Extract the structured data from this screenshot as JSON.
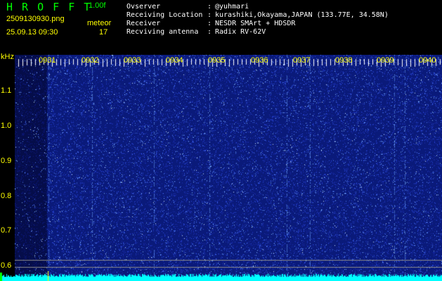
{
  "header": {
    "app_title": "H R O F F T",
    "version": "1.00f",
    "filename": "2509130930.png",
    "datetime": "25.09.13 09:30",
    "meteor_label": "meteor",
    "meteor_count": "17"
  },
  "station_info": [
    {
      "key": "Ovserver",
      "value": "@yuhmari"
    },
    {
      "key": "Receiving Location",
      "value": "kurashiki,Okayama,JAPAN (133.77E, 34.58N)"
    },
    {
      "key": "Receiver",
      "value": "NESDR SMArt + HDSDR"
    },
    {
      "key": "Recviving antenna",
      "value": "Radix RV-62V"
    }
  ],
  "axis": {
    "unit": "kHz",
    "freq_labels": [
      "1.1",
      "1.0",
      "0.9",
      "0.8",
      "0.7",
      "0.6"
    ],
    "time_labels": [
      "0931",
      "0932",
      "0933",
      "0934",
      "0935",
      "0936",
      "0937",
      "0938",
      "0939",
      "0940"
    ]
  },
  "colors": {
    "background": "#000000",
    "title": "#00ff00",
    "labels": "#ffff00",
    "info_text": "#ffffff",
    "spectrogram_base": "#0a1a7a",
    "noise_trace": "#00ffff"
  }
}
